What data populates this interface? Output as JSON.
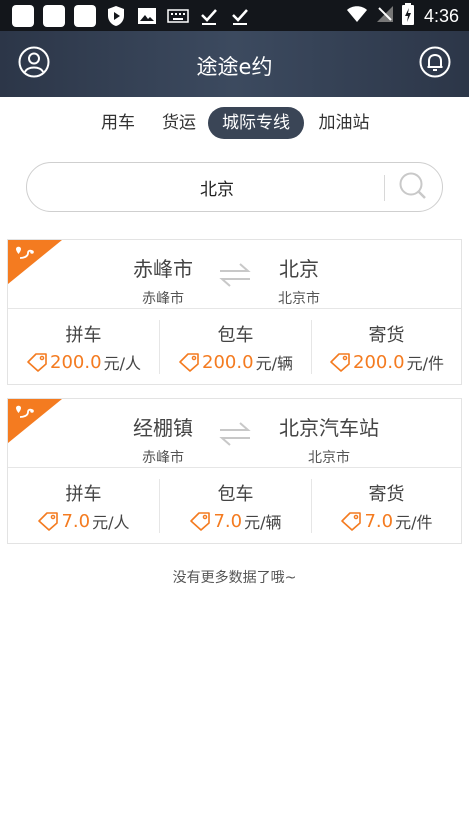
{
  "status_bar": {
    "time": "4:36"
  },
  "header": {
    "title": "途途e约",
    "left_icon": "user-icon",
    "right_icon": "bell-icon"
  },
  "tabs": [
    {
      "label": "用车",
      "active": false
    },
    {
      "label": "货运",
      "active": false
    },
    {
      "label": "城际专线",
      "active": true
    },
    {
      "label": "加油站",
      "active": false
    }
  ],
  "search": {
    "value": "北京",
    "icon": "search-icon"
  },
  "routes": [
    {
      "from": "赤峰市",
      "from_sub": "赤峰市",
      "to": "北京",
      "to_sub": "北京市",
      "options": [
        {
          "name": "拼车",
          "price": "200.0",
          "unit": "元/人"
        },
        {
          "name": "包车",
          "price": "200.0",
          "unit": "元/辆"
        },
        {
          "name": "寄货",
          "price": "200.0",
          "unit": "元/件"
        }
      ]
    },
    {
      "from": "经棚镇",
      "from_sub": "赤峰市",
      "to": "北京汽车站",
      "to_sub": "北京市",
      "options": [
        {
          "name": "拼车",
          "price": "7.0",
          "unit": "元/人"
        },
        {
          "name": "包车",
          "price": "7.0",
          "unit": "元/辆"
        },
        {
          "name": "寄货",
          "price": "7.0",
          "unit": "元/件"
        }
      ]
    }
  ],
  "footer_note": "没有更多数据了哦~",
  "colors": {
    "accent": "#f47b20",
    "header": "#34404f",
    "active_tab": "#3a4556"
  }
}
